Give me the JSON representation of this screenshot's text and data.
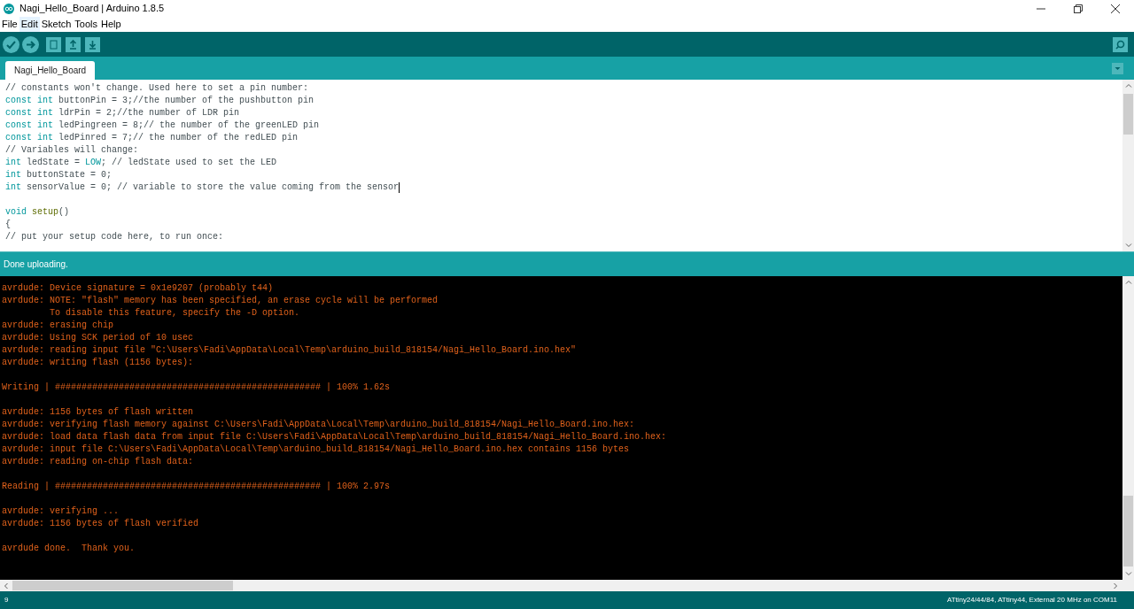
{
  "window": {
    "title": "Nagi_Hello_Board | Arduino 1.8.5"
  },
  "menu": [
    {
      "label": "File",
      "selected": false
    },
    {
      "label": "Edit",
      "selected": true
    },
    {
      "label": "Sketch",
      "selected": false
    },
    {
      "label": "Tools",
      "selected": false
    },
    {
      "label": "Help",
      "selected": false
    }
  ],
  "tabs": [
    {
      "label": "Nagi_Hello_Board",
      "selected": true
    }
  ],
  "editor": {
    "blocks": [
      [
        [
          {
            "kind": "comment",
            "text": "// constants won't change. Used here to set a pin number:"
          }
        ],
        [
          {
            "kind": "keyword",
            "text": "const int"
          },
          {
            "kind": "plain",
            "text": " buttonPin = 3;"
          },
          {
            "kind": "comment",
            "text": "//the number of the pushbutton pin"
          }
        ],
        [
          {
            "kind": "keyword",
            "text": "const int"
          },
          {
            "kind": "plain",
            "text": " ldrPin = 2;"
          },
          {
            "kind": "comment",
            "text": "//the number of LDR pin"
          }
        ],
        [
          {
            "kind": "keyword",
            "text": "const int"
          },
          {
            "kind": "plain",
            "text": " ledPingreen = 8;"
          },
          {
            "kind": "comment",
            "text": "// the number of the greenLED pin"
          }
        ],
        [
          {
            "kind": "keyword",
            "text": "const int"
          },
          {
            "kind": "plain",
            "text": " ledPinred = 7;"
          },
          {
            "kind": "comment",
            "text": "// the number of the redLED pin"
          }
        ],
        [
          {
            "kind": "comment",
            "text": "// Variables will change:"
          }
        ],
        [
          {
            "kind": "keyword",
            "text": "int"
          },
          {
            "kind": "plain",
            "text": " ledState = "
          },
          {
            "kind": "keyword",
            "text": "LOW"
          },
          {
            "kind": "plain",
            "text": "; "
          },
          {
            "kind": "comment",
            "text": "// ledState used to set the LED"
          }
        ],
        [
          {
            "kind": "keyword",
            "text": "int"
          },
          {
            "kind": "plain",
            "text": " buttonState = 0;"
          }
        ],
        [
          {
            "kind": "keyword",
            "text": "int"
          },
          {
            "kind": "plain",
            "text": " sensorValue = 0; "
          },
          {
            "kind": "comment",
            "text": "// variable to store the value coming from the sensor"
          },
          {
            "kind": "caret"
          }
        ]
      ],
      [
        [
          {
            "kind": "keyword",
            "text": "void "
          },
          {
            "kind": "function",
            "text": "setup"
          },
          {
            "kind": "plain",
            "text": "()"
          }
        ],
        [
          {
            "kind": "plain",
            "text": "{"
          }
        ],
        [
          {
            "kind": "comment",
            "text": "// put your setup code here, to run once:"
          }
        ]
      ]
    ]
  },
  "message": "Done uploading.",
  "console": {
    "blocks": [
      [
        "avrdude: Device signature = 0x1e9207 (probably t44)",
        "avrdude: NOTE: \"flash\" memory has been specified, an erase cycle will be performed",
        "         To disable this feature, specify the -D option.",
        "avrdude: erasing chip",
        "avrdude: Using SCK period of 10 usec",
        "avrdude: reading input file \"C:\\Users\\Fadi\\AppData\\Local\\Temp\\arduino_build_818154/Nagi_Hello_Board.ino.hex\"",
        "avrdude: writing flash (1156 bytes):"
      ],
      [
        "Writing | ################################################## | 100% 1.62s"
      ],
      [
        "avrdude: 1156 bytes of flash written",
        "avrdude: verifying flash memory against C:\\Users\\Fadi\\AppData\\Local\\Temp\\arduino_build_818154/Nagi_Hello_Board.ino.hex:",
        "avrdude: load data flash data from input file C:\\Users\\Fadi\\AppData\\Local\\Temp\\arduino_build_818154/Nagi_Hello_Board.ino.hex:",
        "avrdude: input file C:\\Users\\Fadi\\AppData\\Local\\Temp\\arduino_build_818154/Nagi_Hello_Board.ino.hex contains 1156 bytes",
        "avrdude: reading on-chip flash data:"
      ],
      [
        "Reading | ################################################## | 100% 2.97s"
      ],
      [
        "avrdude: verifying ...",
        "avrdude: 1156 bytes of flash verified"
      ],
      [
        "avrdude done.  Thank you."
      ]
    ]
  },
  "status_bar": {
    "line": "9",
    "board": "ATtiny24/44/84, ATtiny44, External 20 MHz on COM11"
  }
}
